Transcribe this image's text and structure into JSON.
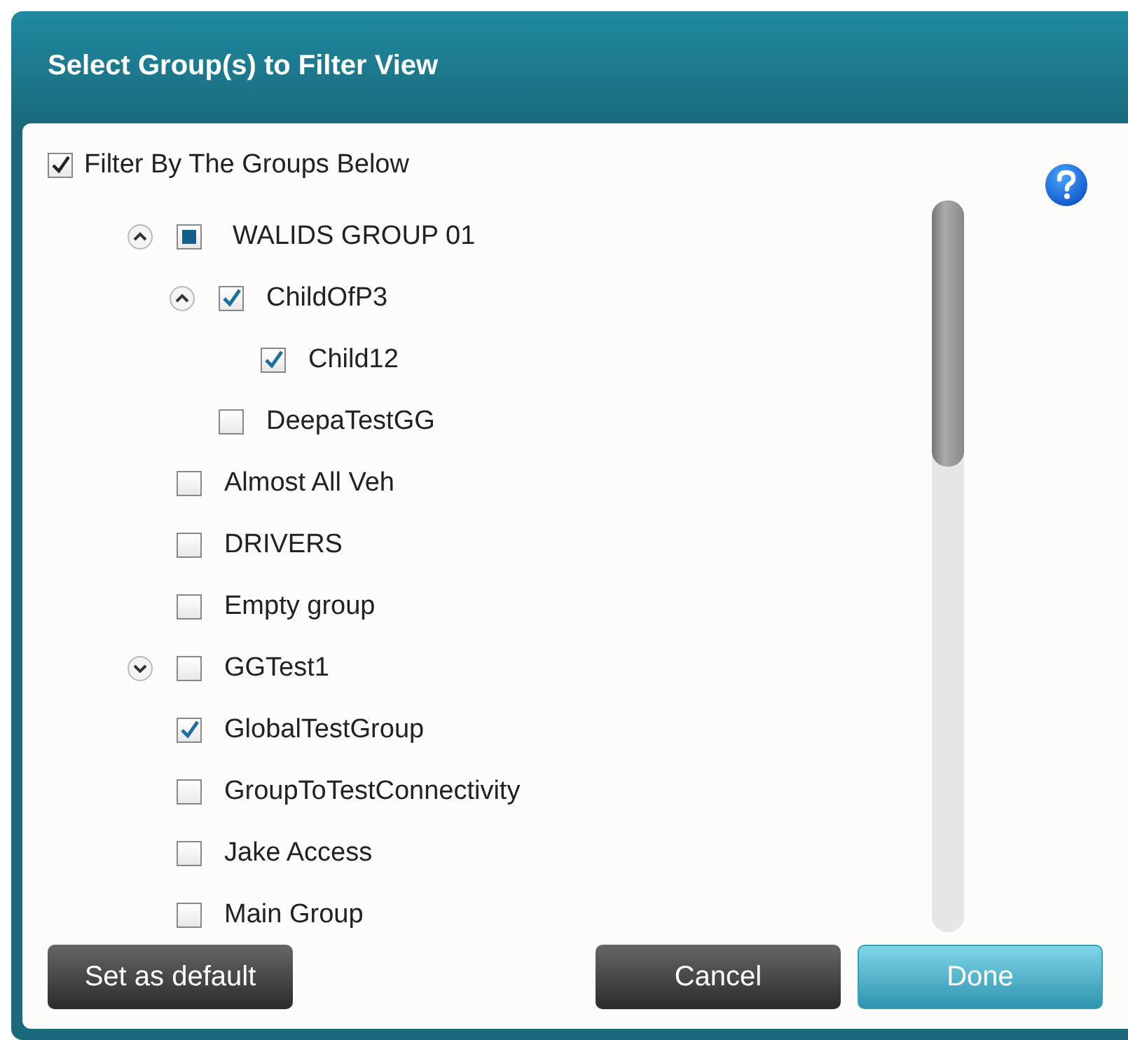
{
  "dialog": {
    "title": "Select Group(s) to Filter View"
  },
  "filter": {
    "label": "Filter By The Groups Below",
    "checked": true
  },
  "groups": [
    {
      "label": "WALIDS GROUP 01",
      "checked": false,
      "partial": true,
      "expanded": true,
      "children": [
        {
          "label": "ChildOfP3",
          "checked": true,
          "expanded": true,
          "children": [
            {
              "label": "Child12",
              "checked": true
            }
          ]
        },
        {
          "label": "DeepaTestGG",
          "checked": false
        }
      ]
    },
    {
      "label": "Almost All Veh",
      "checked": false
    },
    {
      "label": "DRIVERS",
      "checked": false
    },
    {
      "label": "Empty group",
      "checked": false
    },
    {
      "label": "GGTest1",
      "checked": false,
      "expanded": false
    },
    {
      "label": "GlobalTestGroup",
      "checked": true
    },
    {
      "label": "GroupToTestConnectivity",
      "checked": false
    },
    {
      "label": "Jake Access",
      "checked": false
    },
    {
      "label": "Main Group",
      "checked": false
    }
  ],
  "buttons": [
    {
      "label": "Set as default",
      "kind": "secondary"
    },
    {
      "label": "Cancel",
      "kind": "secondary"
    },
    {
      "label": "Done",
      "kind": "primary"
    }
  ]
}
